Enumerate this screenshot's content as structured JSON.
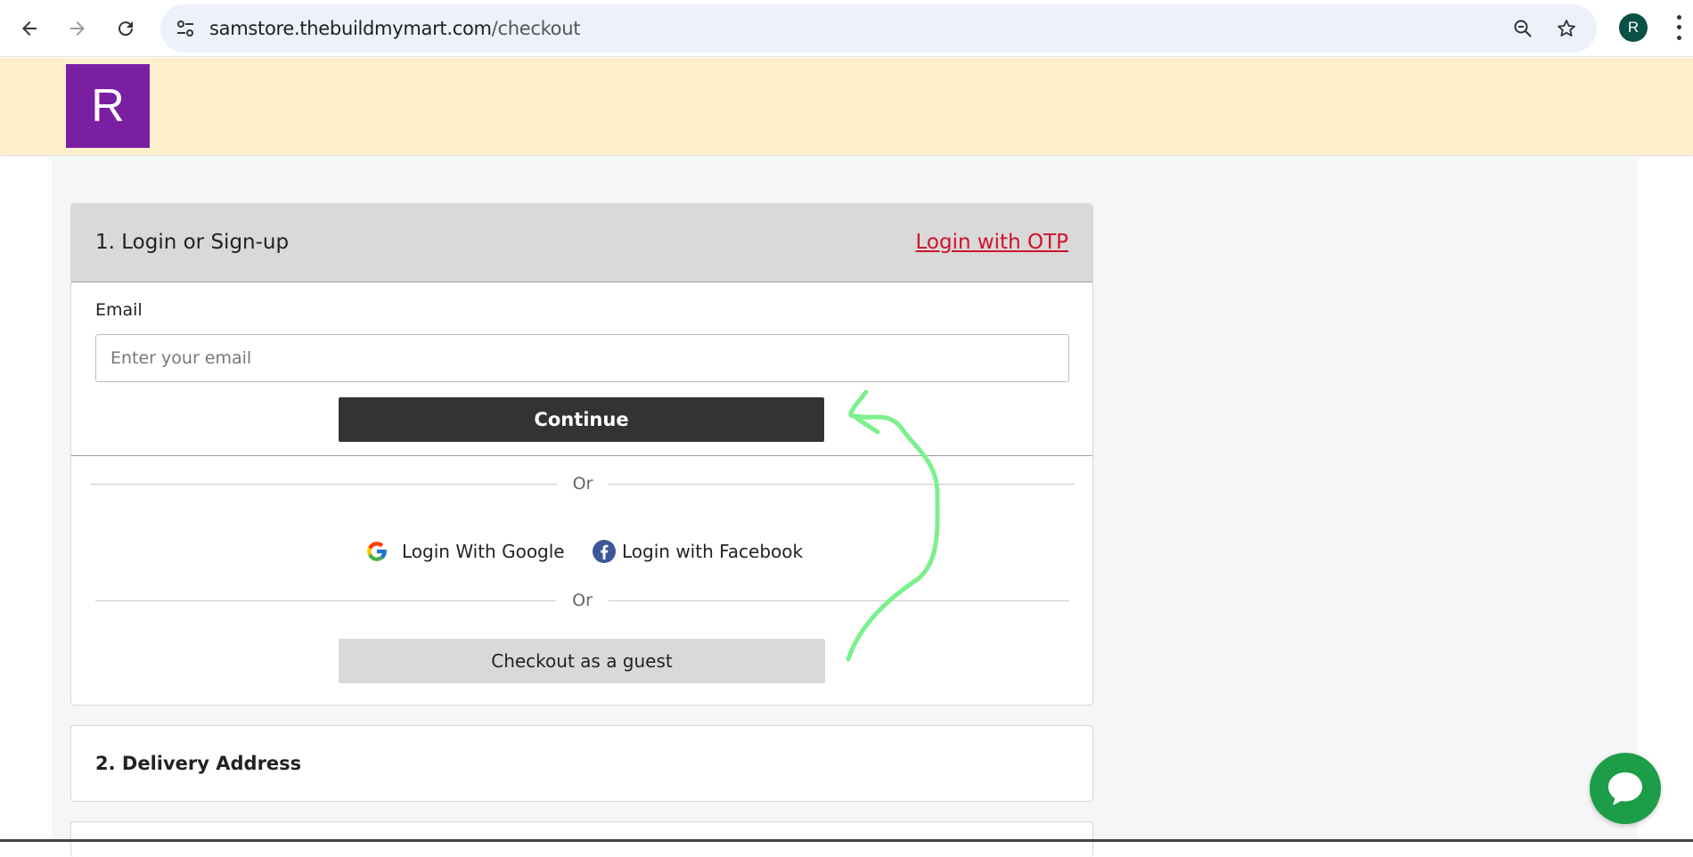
{
  "browser": {
    "url_host": "samstore.thebuildmymart.com",
    "url_path": "/checkout",
    "profile_initial": "R",
    "icons": {
      "back": "arrow-left-icon",
      "forward": "arrow-right-icon",
      "reload": "reload-icon",
      "site_info": "tune-icon",
      "zoom": "zoom-out-icon",
      "bookmark": "star-icon",
      "menu": "kebab-menu-icon"
    }
  },
  "header": {
    "logo_letter": "R",
    "logo_color": "#7b1fa2",
    "background_color": "#fff0cc"
  },
  "login_section": {
    "title": "1. Login or Sign-up",
    "otp_link": "Login with OTP",
    "email_label": "Email",
    "email_value": "",
    "email_placeholder": "Enter your email",
    "continue_label": "Continue",
    "or_text_1": "Or",
    "google_label": "Login With Google",
    "facebook_label": "Login with Facebook",
    "or_text_2": "Or",
    "guest_label": "Checkout as a guest"
  },
  "delivery_section": {
    "title": "2. Delivery Address"
  },
  "chat": {
    "icon": "chat-bubble-icon",
    "color": "#1e9d48"
  },
  "annotation": {
    "color": "#7cf08c",
    "type": "hand-drawn-arrow"
  }
}
